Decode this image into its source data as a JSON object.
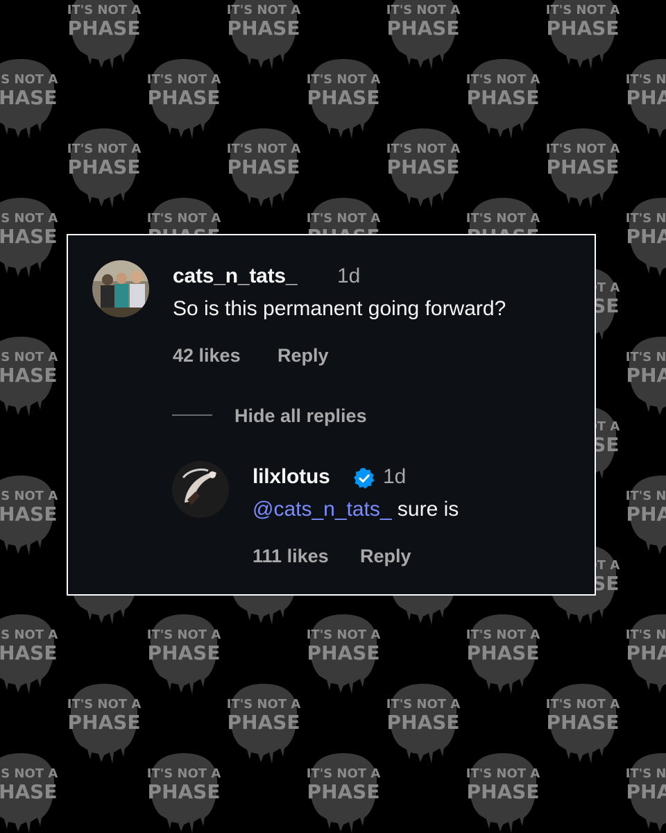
{
  "background": {
    "color": "#000000",
    "pattern_logo_text": [
      "IT'S NOT A",
      "PHASE"
    ],
    "pattern_color": "#6e6e6e"
  },
  "card": {
    "background": "#0d1014",
    "border": "#ffffff"
  },
  "comment": {
    "username": "cats_n_tats_",
    "time": "1d",
    "text": "So is this permanent going forward?",
    "likes": "42 likes",
    "reply_label": "Reply"
  },
  "replies": {
    "toggle_label": "Hide all replies"
  },
  "reply": {
    "username": "lilxlotus",
    "verified": true,
    "time": "1d",
    "mention": "@cats_n_tats_",
    "text": " sure is",
    "likes": "111 likes",
    "reply_label": "Reply"
  },
  "colors": {
    "text_primary": "#f5f5f5",
    "text_secondary": "#a8a8a8",
    "mention": "#7b8cff",
    "verified_badge": "#0095f6"
  },
  "icons": {
    "verified": "verified-badge-icon"
  }
}
